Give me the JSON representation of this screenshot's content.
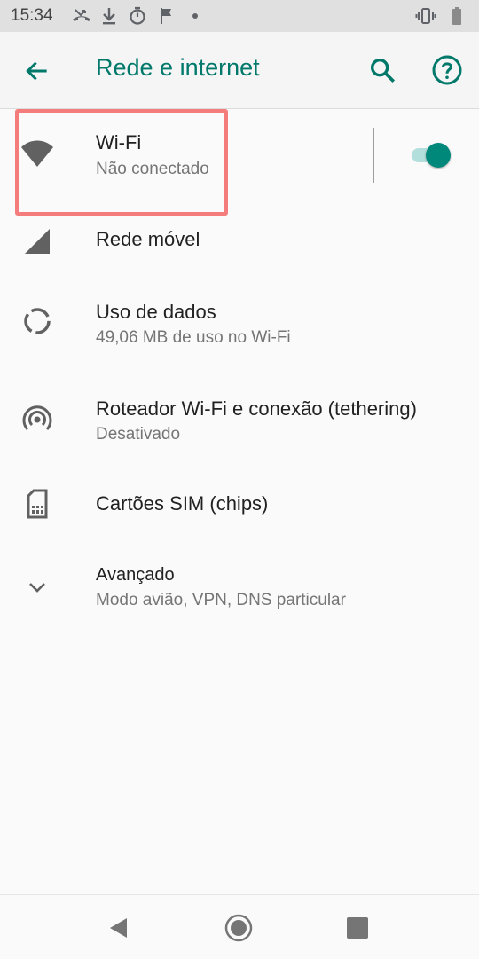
{
  "status_bar": {
    "time": "15:34",
    "left_icons": [
      "missed-call-icon",
      "download-icon",
      "timer-icon",
      "flag-icon",
      "dot-icon"
    ],
    "right_icons": [
      "vibrate-icon",
      "battery-icon"
    ]
  },
  "app_bar": {
    "title": "Rede e internet",
    "accent_color": "#00796b"
  },
  "items": [
    {
      "id": "wifi",
      "title": "Wi-Fi",
      "subtitle": "Não conectado",
      "icon": "wifi-icon",
      "toggle_on": true
    },
    {
      "id": "mobile",
      "title": "Rede móvel",
      "subtitle": "",
      "icon": "signal-icon"
    },
    {
      "id": "data-usage",
      "title": "Uso de dados",
      "subtitle": "49,06 MB de uso no Wi-Fi",
      "icon": "data-usage-icon"
    },
    {
      "id": "hotspot",
      "title": "Roteador Wi-Fi e conexão (tethering)",
      "subtitle": "Desativado",
      "icon": "hotspot-icon"
    },
    {
      "id": "sim",
      "title": "Cartões SIM (chips)",
      "subtitle": "",
      "icon": "sim-card-icon"
    },
    {
      "id": "advanced",
      "title": "Avançado",
      "subtitle": "Modo avião, VPN, DNS particular",
      "icon": "chevron-down-icon"
    }
  ],
  "nav_bar": {
    "icons": [
      "back-triangle-icon",
      "home-circle-icon",
      "recents-square-icon"
    ]
  },
  "colors": {
    "toggle_thumb": "#00897b",
    "toggle_track": "#b2dfdb",
    "highlight": "#f47c7c"
  }
}
